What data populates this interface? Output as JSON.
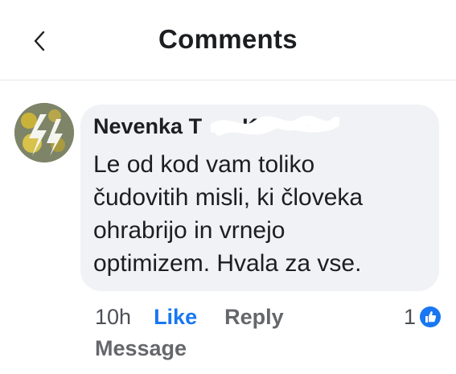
{
  "header": {
    "title": "Comments",
    "back_icon": "chevron-left-icon"
  },
  "comment": {
    "author": "Nevenka T",
    "author_tail": "K",
    "text": "Le od kod vam toliko\nčudovitih misli, ki človeka\nohrabrijo in vrnejo\noptimizem. Hvala za vse.",
    "time": "10h",
    "like_label": "Like",
    "reply_label": "Reply",
    "reaction_count": "1",
    "reaction_icon": "thumbs-up-icon",
    "message_label": "Message"
  },
  "colors": {
    "accent": "#1877f2",
    "bubble": "#f0f2f5",
    "secondary_text": "#65676b"
  }
}
